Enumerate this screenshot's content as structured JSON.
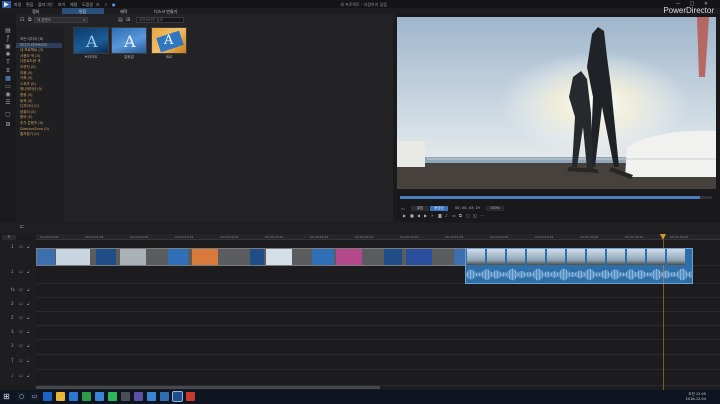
{
  "titlebar": {
    "menu": [
      "파일",
      "편집",
      "플러그인",
      "보기",
      "재생",
      "도움말"
    ],
    "title": "새 프로젝트 - 저장하지 않음",
    "min": "—",
    "max": "□",
    "close": "✕"
  },
  "top_tabs": [
    "캡처",
    "편집",
    "제작",
    "디스크 만들기"
  ],
  "brand": "PowerDirector",
  "library": {
    "filter_value": "내 콘텐츠",
    "search_placeholder": "라이브러리 검색",
    "tree": [
      {
        "label": "모든 미디어 (8)",
        "orange": false
      },
      {
        "label": "미디어 라이브러리",
        "orange": false
      },
      {
        "label": "내 프로젝트 (3)",
        "orange": true
      },
      {
        "label": "사용자 색 (3)",
        "orange": true
      },
      {
        "label": "다운로드한 색",
        "orange": true
      },
      {
        "label": "오렌지 (0)",
        "orange": true
      },
      {
        "label": "여행 (0)",
        "orange": true
      },
      {
        "label": "가족 (0)",
        "orange": true
      },
      {
        "label": "스포츠 (0)",
        "orange": true
      },
      {
        "label": "애니메이션 (0)",
        "orange": true
      },
      {
        "label": "원형 (0)",
        "orange": true
      },
      {
        "label": "동적 (0)",
        "orange": true
      },
      {
        "label": "디자이너 (0)",
        "orange": true
      },
      {
        "label": "컴퓨터 (0)",
        "orange": true
      },
      {
        "label": "음악 (0)",
        "orange": true
      },
      {
        "label": "추가 콘텐츠 (0)",
        "orange": true
      },
      {
        "label": "DirectorZone (0)",
        "orange": true
      },
      {
        "label": "즐겨찾기 (0)",
        "orange": true
      }
    ],
    "thumbs": [
      {
        "label": "브라이트"
      },
      {
        "label": "말랑말"
      },
      {
        "label": "세로"
      }
    ]
  },
  "preview": {
    "mode_clip": "클립",
    "mode_movie": "동영상",
    "timecode": "00; 00; 43; 19",
    "quality": "100%"
  },
  "timeline": {
    "ruler": [
      "00;00;00;00",
      "00;00;04;29",
      "00;00;09;29",
      "00;00;14;29",
      "00;00;19;29",
      "00;00;24;29",
      "00;00;29;29",
      "00;00;34;29",
      "00;00;39;29",
      "00;00;44;29",
      "00;00;49;29",
      "00;00;54;29",
      "00;01;00;00",
      "00;01;04;29",
      "00;01;09;29"
    ],
    "tracks": [
      {
        "label": "1"
      },
      {
        "label": "1"
      },
      {
        "label": "fx"
      },
      {
        "label": "2"
      },
      {
        "label": "2"
      },
      {
        "label": "3"
      },
      {
        "label": "3"
      },
      {
        "label": "T"
      },
      {
        "label": "♪"
      }
    ]
  },
  "taskbar": {
    "time": "오전 12:45",
    "date": "2018-12-04"
  },
  "colors": {
    "accent": "#3a72c0",
    "playhead": "#d39a2b",
    "audio": "#2f6fa8"
  }
}
